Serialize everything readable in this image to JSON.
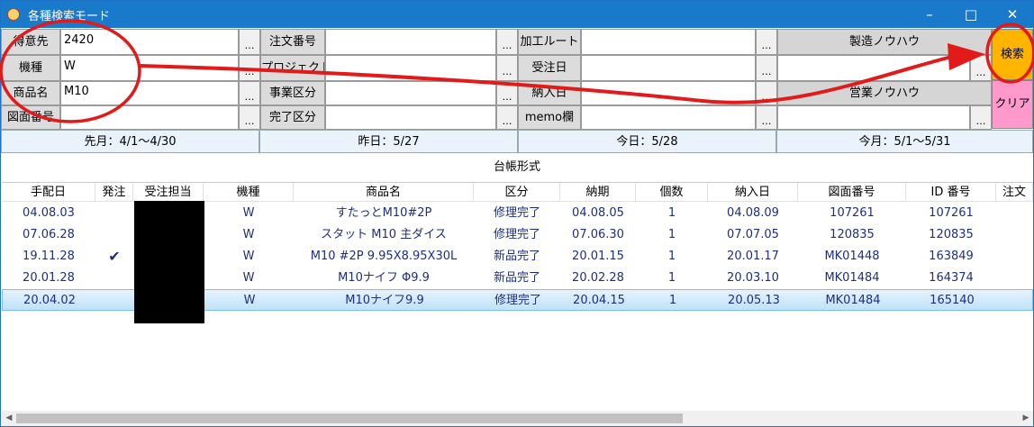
{
  "window": {
    "title": "各種検索モード"
  },
  "form": {
    "col1": [
      {
        "label": "得意先",
        "value": "2420"
      },
      {
        "label": "機種",
        "value": "W"
      },
      {
        "label": "商品名",
        "value": "M10"
      },
      {
        "label": "図面番号",
        "value": ""
      }
    ],
    "col2": [
      {
        "label": "注文番号",
        "value": ""
      },
      {
        "label": "プロジェクト",
        "value": ""
      },
      {
        "label": "事業区分",
        "value": ""
      },
      {
        "label": "完了区分",
        "value": ""
      }
    ],
    "col3": [
      {
        "label": "加工ルート",
        "value": ""
      },
      {
        "label": "受注日",
        "value": ""
      },
      {
        "label": "納入日",
        "value": ""
      },
      {
        "label": "memo欄",
        "value": ""
      }
    ],
    "browse": "…",
    "seizo": "製造ノウハウ",
    "eigyo": "営業ノウハウ",
    "search": "検索",
    "clear": "クリア"
  },
  "months": {
    "last": "先月：4/1〜4/30",
    "yesterday": "昨日：5/27",
    "today": "今日：5/28",
    "this": "今月：5/1〜5/31"
  },
  "ledger_title": "台帳形式",
  "grid": {
    "columns": [
      "手配日",
      "発注",
      "受注担当",
      "機種",
      "商品名",
      "区分",
      "納期",
      "個数",
      "納入日",
      "図面番号",
      "ID 番号",
      "注文"
    ],
    "rows": [
      {
        "tehai": "04.08.03",
        "hacchu": "",
        "tanto": "",
        "kishu": "W",
        "shohin": "すたっとM10#2P",
        "kubun": "修理完了",
        "noki": "04.08.05",
        "kosu": "1",
        "nonyu": "04.08.09",
        "zumen": "107261",
        "id": "107261"
      },
      {
        "tehai": "07.06.28",
        "hacchu": "",
        "tanto": "",
        "kishu": "W",
        "shohin": "スタット M10 主ダイス",
        "kubun": "修理完了",
        "noki": "07.06.30",
        "kosu": "1",
        "nonyu": "07.07.05",
        "zumen": "120835",
        "id": "120835"
      },
      {
        "tehai": "19.11.28",
        "hacchu": "✔",
        "tanto": "",
        "kishu": "W",
        "shohin": "M10 #2P 9.95X8.95X30L",
        "kubun": "新品完了",
        "noki": "20.01.15",
        "kosu": "1",
        "nonyu": "20.01.17",
        "zumen": "MK01448",
        "id": "163849"
      },
      {
        "tehai": "20.01.28",
        "hacchu": "",
        "tanto": "",
        "kishu": "W",
        "shohin": "M10ナイフ Φ9.9",
        "kubun": "新品完了",
        "noki": "20.02.28",
        "kosu": "1",
        "nonyu": "20.03.10",
        "zumen": "MK01484",
        "id": "164374"
      },
      {
        "tehai": "20.04.02",
        "hacchu": "",
        "tanto": "",
        "kishu": "W",
        "shohin": "M10ナイフ9.9",
        "kubun": "修理完了",
        "noki": "20.04.15",
        "kosu": "1",
        "nonyu": "20.05.13",
        "zumen": "MK01484",
        "id": "165140"
      }
    ],
    "selected_row": 4
  },
  "icons": {
    "app": "app-icon",
    "minimize": "minimize-icon",
    "maximize": "maximize-icon",
    "close": "close-icon",
    "check": "check-icon"
  },
  "colors": {
    "titlebar": "#1979ca",
    "search": "#ffb400",
    "clear": "#ff99cc",
    "annotation": "#e21a1a"
  }
}
